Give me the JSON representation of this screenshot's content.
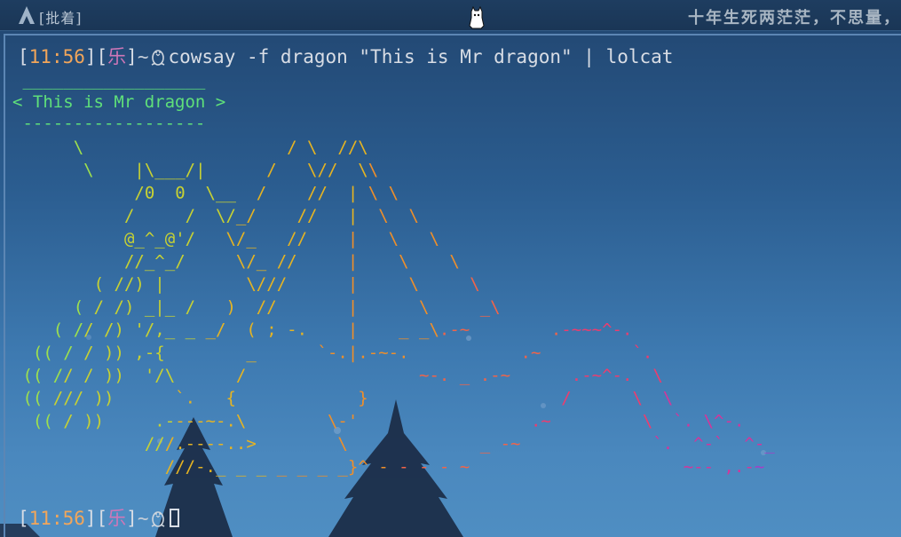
{
  "topbar": {
    "workspace": "[批着]",
    "poem": "十年生死两茫茫，不思量，"
  },
  "terminal": {
    "time": "11:56",
    "host": "乐",
    "tilde": "~",
    "command": "cowsay -f dragon \"This is Mr dragon\" | lolcat",
    "speech_top": " __________________",
    "speech_text": "< This is Mr dragon >",
    "speech_bottom": " ------------------",
    "dragon_lines": [
      "      \\                    / \\  //\\",
      "       \\    |\\___/|      /   \\//  \\\\",
      "            /0  0  \\__  /    //  | \\ \\",
      "           /     /  \\/_/    //   |  \\  \\",
      "           @_^_@'/   \\/_   //    |   \\   \\",
      "           //_^_/     \\/_ //     |    \\    \\",
      "        ( //) |        \\///      |     \\     \\",
      "      ( / /) _|_ /   )  //       |      \\     _\\",
      "    ( // /) '/,_ _ _/  ( ; -.    |    _ _\\.-~        .-~~~^-.",
      "  (( / / )) ,-{        _      `-.|.-~-.           .~         `.",
      " (( // / ))  '/\\      /                 ~-. _ .-~      .-~^-.  \\",
      " (( /// ))      `.   {            }                   /      \\  \\",
      "  (( / ))     .----~-.\\        \\-'                 .~         \\  `. \\^-.",
      "             ///.----..>        \\             _ -~             `.  ^-`  ^-_",
      "               ///-._ _ _ _ _ _ _}^ - - - - ~                     ~-- ,.-~"
    ]
  },
  "colors": {
    "speech": "#5fe07a",
    "dragon_gradient": [
      "#9ee04d",
      "#c8d232",
      "#e6b422",
      "#ef8f2a",
      "#f26448",
      "#ee3c6e",
      "#d4369b",
      "#a83cc7",
      "#7a46e0"
    ]
  }
}
